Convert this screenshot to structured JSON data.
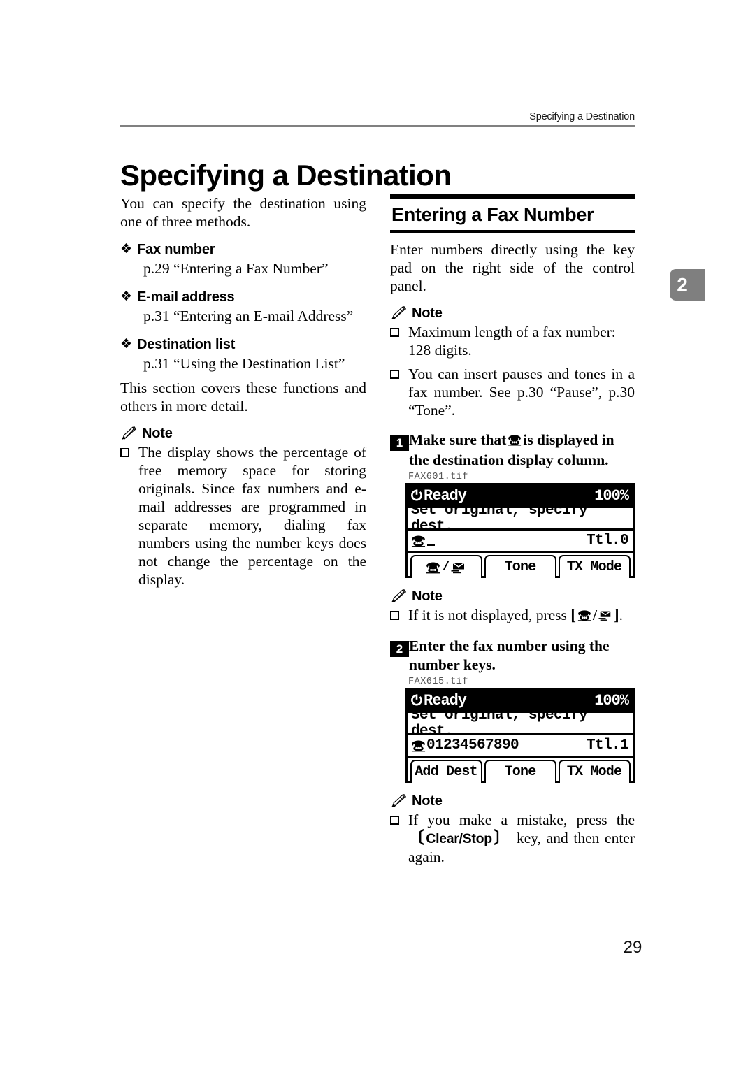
{
  "header": {
    "running_title": "Specifying a Destination"
  },
  "chapter_tab": {
    "number": "2",
    "color": "#7f7f7f"
  },
  "title": "Specifying a Destination",
  "left_column": {
    "intro": "You can specify the destination using one of three methods.",
    "methods": [
      {
        "bullet": "diamond-bullet",
        "label": "Fax number",
        "reference": "p.29 “Entering a Fax Number”"
      },
      {
        "bullet": "diamond-bullet",
        "label": "E-mail address",
        "reference": "p.31 “Entering an E-mail Address”"
      },
      {
        "bullet": "diamond-bullet",
        "label": "Destination list",
        "reference": "p.31 “Using the Destination List”"
      }
    ],
    "closing": "This section covers these functions and others in more detail.",
    "note": {
      "icon": "pencil-icon",
      "label": "Note",
      "items": [
        "The display shows the percentage of free memory space for storing originals. Since fax numbers and e-mail addresses are programmed in separate memory, dialing fax numbers using the number keys does not change the percentage on the display."
      ]
    }
  },
  "right_column": {
    "section_title": "Entering a Fax Number",
    "intro": "Enter numbers directly using the key pad on the right side of the control panel.",
    "note1": {
      "icon": "pencil-icon",
      "label": "Note",
      "items": [
        "Maximum length of a fax number: 128 digits.",
        "You can insert pauses and tones in a fax number. See p.30 “Pause”, p.30 “Tone”."
      ]
    },
    "step1": {
      "number": "1",
      "text_before": "Make sure that",
      "inline_icon": "telephone-icon",
      "text_after": "is displayed in the destination display column."
    },
    "figure1": {
      "caption": "FAX601.tif",
      "status_icon": "power-icon",
      "status_text": "Ready",
      "status_percent": "100%",
      "message": "Set original, specify dest.",
      "dest_icon": "telephone-icon",
      "dest_value": "",
      "dest_total": "Ttl.0",
      "softkeys": [
        {
          "icons": [
            "telephone-icon",
            "envelope-icon"
          ],
          "separator": "/",
          "label": ""
        },
        {
          "icons": [],
          "label": "Tone"
        },
        {
          "icons": [],
          "label": "TX Mode"
        }
      ]
    },
    "note2": {
      "icon": "pencil-icon",
      "label": "Note",
      "item_before": "If it is not displayed, press",
      "key_icons": [
        "telephone-icon",
        "envelope-icon"
      ],
      "key_separator": "/",
      "item_after": "."
    },
    "step2": {
      "number": "2",
      "text": "Enter the fax number using the number keys."
    },
    "figure2": {
      "caption": "FAX615.tif",
      "status_icon": "power-icon",
      "status_text": "Ready",
      "status_percent": "100%",
      "message": "Set original, specify dest.",
      "dest_icon": "telephone-icon",
      "dest_value": "01234567890",
      "dest_total": "Ttl.1",
      "softkeys": [
        {
          "icons": [],
          "label": "Add Dest"
        },
        {
          "icons": [],
          "label": "Tone"
        },
        {
          "icons": [],
          "label": "TX Mode"
        }
      ]
    },
    "note3": {
      "icon": "pencil-icon",
      "label": "Note",
      "item_before": "If you make a mistake, press the",
      "key_label": "Clear/Stop",
      "item_after": "key, and then enter again."
    }
  },
  "page_number": "29"
}
